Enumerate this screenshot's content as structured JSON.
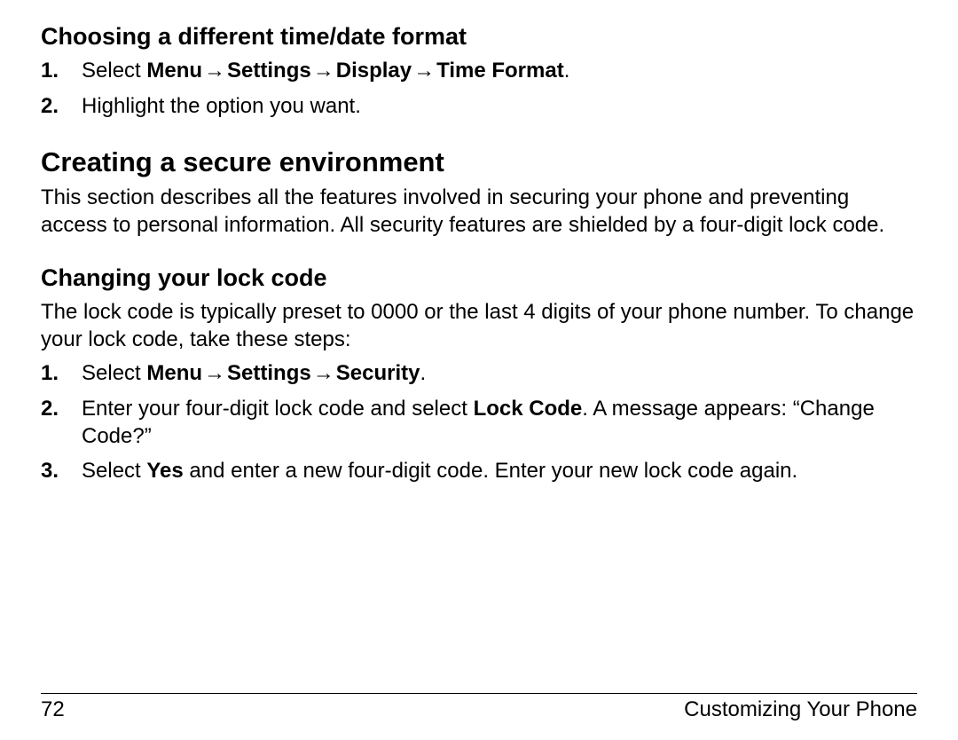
{
  "arrow": "→",
  "section1": {
    "heading": "Choosing a different time/date format",
    "step1": {
      "lead": "Select ",
      "path": [
        "Menu",
        "Settings",
        "Display",
        "Time Format"
      ],
      "tail": "."
    },
    "step2": "Highlight the option you want."
  },
  "section2": {
    "heading": "Creating a secure environment",
    "para": "This section describes all the features involved in securing your phone and preventing access to personal information. All security features are shielded by a four-digit lock code."
  },
  "section3": {
    "heading": "Changing your lock code",
    "para": "The lock code is typically preset to 0000 or the last 4 digits of your phone number. To change your lock code, take these steps:",
    "step1": {
      "lead": "Select ",
      "path": [
        "Menu",
        "Settings",
        "Security"
      ],
      "tail": "."
    },
    "step2": {
      "pre": "Enter your four-digit lock code and select ",
      "bold": "Lock Code",
      "post": ". A message appears: “Change Code?”"
    },
    "step3": {
      "pre": "Select ",
      "bold": "Yes",
      "post": " and enter a new four-digit code. Enter your new lock code again."
    }
  },
  "footer": {
    "page": "72",
    "title": "Customizing Your Phone"
  }
}
